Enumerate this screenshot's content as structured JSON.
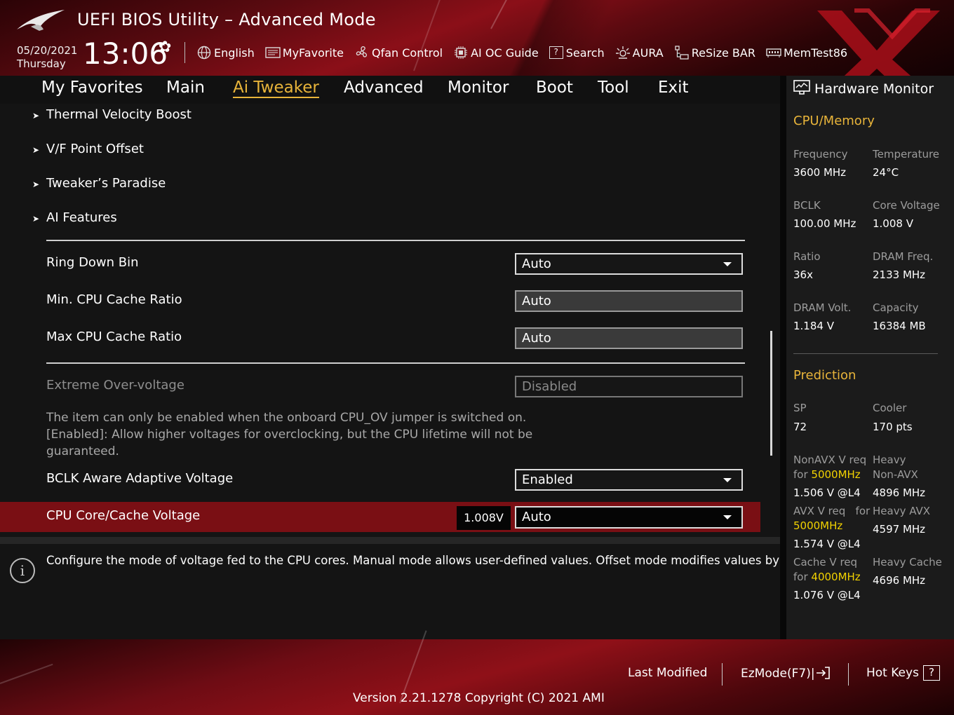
{
  "app": {
    "title": "UEFI BIOS Utility – Advanced Mode"
  },
  "datetime": {
    "date": "05/20/2021",
    "day": "Thursday",
    "time": "13:06"
  },
  "toolbar": {
    "english": "English",
    "myfavorite": "MyFavorite",
    "qfan": "Qfan Control",
    "aioc": "AI OC Guide",
    "search": "Search",
    "aura": "AURA",
    "resizebar": "ReSize BAR",
    "memtest": "MemTest86"
  },
  "nav": {
    "tabs": [
      "My Favorites",
      "Main",
      "Ai Tweaker",
      "Advanced",
      "Monitor",
      "Boot",
      "Tool",
      "Exit"
    ],
    "active": "Ai Tweaker"
  },
  "submenus": [
    "Thermal Velocity Boost",
    "V/F Point Offset",
    "Tweaker’s Paradise",
    "AI Features"
  ],
  "settings": {
    "ring_down_bin": {
      "label": "Ring Down Bin",
      "value": "Auto"
    },
    "min_cache": {
      "label": "Min. CPU Cache Ratio",
      "value": "Auto"
    },
    "max_cache": {
      "label": "Max CPU Cache Ratio",
      "value": "Auto"
    },
    "extreme_ov": {
      "label": "Extreme Over-voltage",
      "value": "Disabled"
    },
    "extreme_ov_help": [
      "The item can only be enabled when the onboard CPU_OV jumper is switched on.",
      "[Enabled]: Allow higher voltages for overclocking, but the CPU lifetime will not be",
      "guaranteed."
    ],
    "bclk_aware": {
      "label": "BCLK Aware Adaptive Voltage",
      "value": "Enabled"
    },
    "cpu_core_cache": {
      "label": "CPU Core/Cache Voltage",
      "current": "1.008V",
      "value": "Auto"
    }
  },
  "info_text": "Configure the mode of voltage fed to the CPU cores. Manual mode allows user-defined values. Offset mode modifies values by SVID.",
  "hw_monitor": {
    "title": "Hardware Monitor",
    "cpu_memory": {
      "heading": "CPU/Memory",
      "frequency": {
        "label": "Frequency",
        "value": "3600 MHz"
      },
      "temperature": {
        "label": "Temperature",
        "value": "24°C"
      },
      "bclk": {
        "label": "BCLK",
        "value": "100.00 MHz"
      },
      "core_voltage": {
        "label": "Core Voltage",
        "value": "1.008 V"
      },
      "ratio": {
        "label": "Ratio",
        "value": "36x"
      },
      "dram_freq": {
        "label": "DRAM Freq.",
        "value": "2133 MHz"
      },
      "dram_volt": {
        "label": "DRAM Volt.",
        "value": "1.184 V"
      },
      "capacity": {
        "label": "Capacity",
        "value": "16384 MB"
      }
    },
    "prediction": {
      "heading": "Prediction",
      "sp": {
        "label": "SP",
        "value": "72"
      },
      "cooler": {
        "label": "Cooler",
        "value": "170 pts"
      },
      "nonavx_req": {
        "label": "NonAVX V req",
        "for": "for",
        "freq": "5000MHz",
        "value": "1.506 V @L4"
      },
      "heavy_nonavx": {
        "label1": "Heavy",
        "label2": "Non-AVX",
        "value": "4896 MHz"
      },
      "avx_req": {
        "label": "AVX V req",
        "for": "for",
        "freq": "5000MHz",
        "value": "1.574 V @L4"
      },
      "heavy_avx": {
        "label": "Heavy AVX",
        "value": "4597 MHz"
      },
      "cache_req": {
        "label": "Cache V req",
        "for": "for",
        "freq": "4000MHz",
        "value": "1.076 V @L4"
      },
      "heavy_cache": {
        "label": "Heavy Cache",
        "value": "4696 MHz"
      }
    }
  },
  "footer": {
    "last_modified": "Last Modified",
    "ezmode": "EzMode(F7)|",
    "hotkeys": "Hot Keys",
    "hotkeys_key": "?",
    "version": "Version 2.21.1278 Copyright (C) 2021 AMI"
  },
  "colors": {
    "accent": "#e8b43a",
    "selection": "#7a0f14",
    "highlight": "#f2d200"
  }
}
